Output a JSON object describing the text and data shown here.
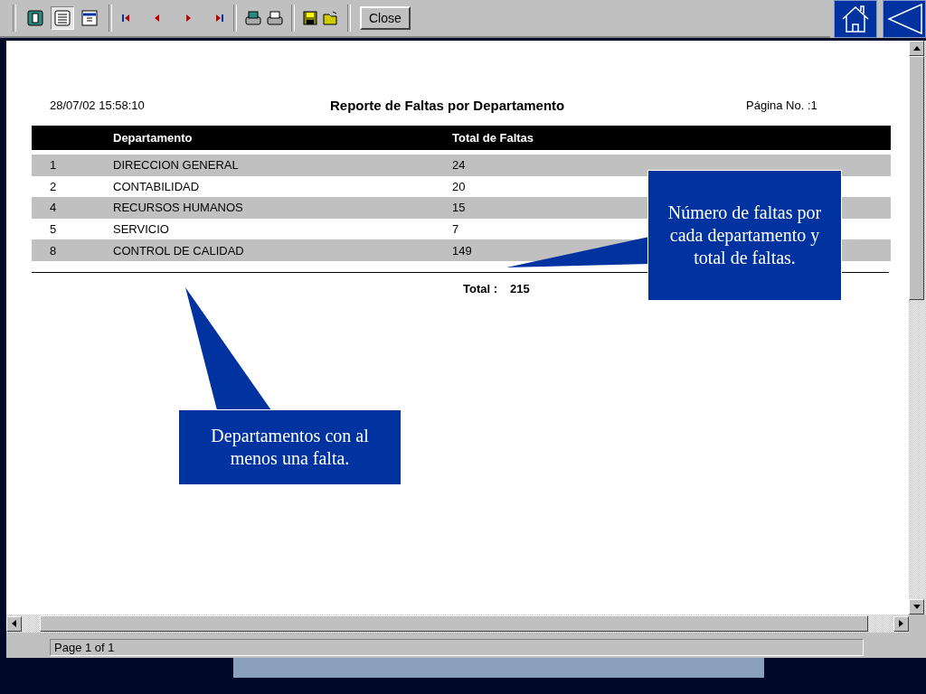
{
  "toolbar": {
    "view_buttons": [
      {
        "selected": false
      },
      {
        "selected": true
      },
      {
        "selected": false
      }
    ],
    "close_label": "Close"
  },
  "report": {
    "timestamp": "28/07/02 15:58:10",
    "title": "Reporte de Faltas por Departamento",
    "page_label": "Página No. :1",
    "columns": [
      "Departamento",
      "Total de Faltas"
    ],
    "rows": [
      {
        "id": "1",
        "department": "DIRECCION GENERAL",
        "total": "24"
      },
      {
        "id": "2",
        "department": "CONTABILIDAD",
        "total": "20"
      },
      {
        "id": "4",
        "department": "RECURSOS HUMANOS",
        "total": "15"
      },
      {
        "id": "5",
        "department": "SERVICIO",
        "total": "7"
      },
      {
        "id": "8",
        "department": "CONTROL DE CALIDAD",
        "total": "149"
      }
    ],
    "total_label": "Total :",
    "total_value": "215"
  },
  "status_bar": {
    "page": "Page 1 of 1"
  },
  "callouts": [
    {
      "text": "Número de faltas por cada departamento y total de faltas."
    },
    {
      "text": "Departamentos con al menos una falta."
    }
  ]
}
